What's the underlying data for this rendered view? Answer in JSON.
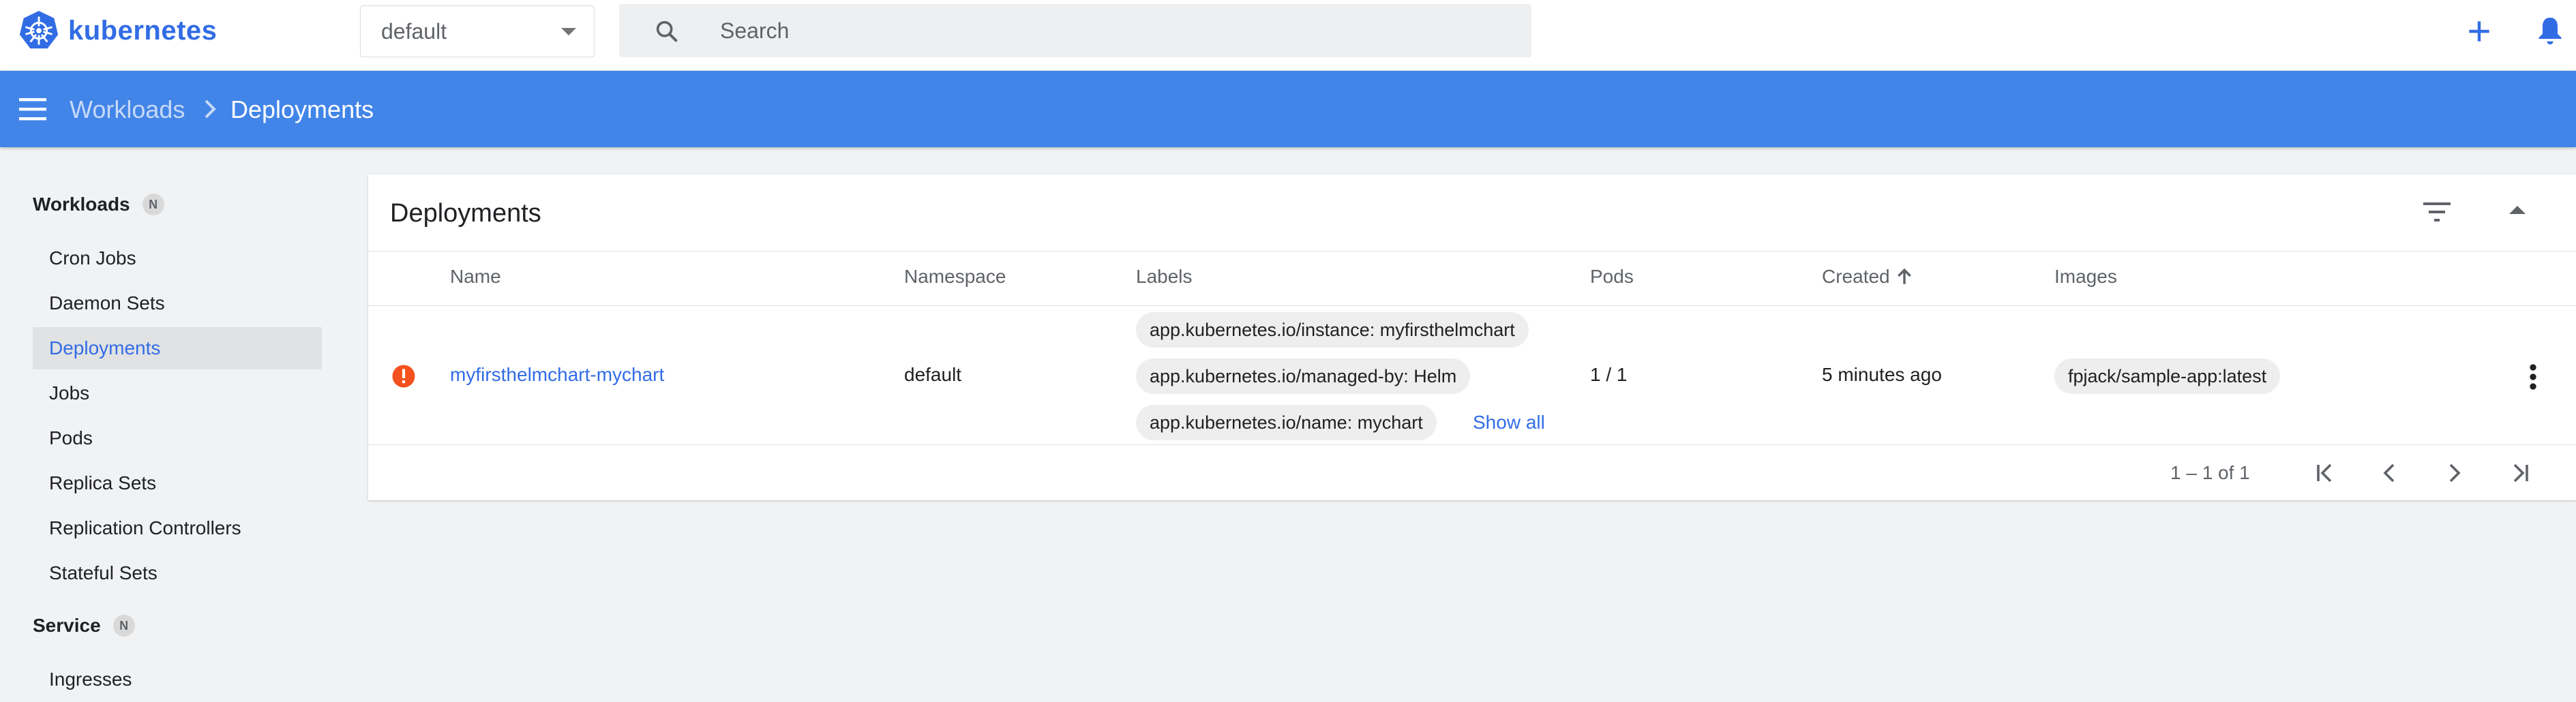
{
  "app": {
    "title": "kubernetes"
  },
  "namespace": {
    "value": "default"
  },
  "search": {
    "placeholder": "Search"
  },
  "header": {
    "breadcrumb": {
      "parent": "Workloads",
      "current": "Deployments"
    }
  },
  "sidebar": {
    "groups": [
      {
        "label": "Workloads",
        "badge": "N"
      },
      {
        "label": "Service",
        "badge": "N"
      }
    ],
    "items": [
      {
        "label": "Cron Jobs"
      },
      {
        "label": "Daemon Sets"
      },
      {
        "label": "Deployments",
        "active": true
      },
      {
        "label": "Jobs"
      },
      {
        "label": "Pods"
      },
      {
        "label": "Replica Sets"
      },
      {
        "label": "Replication Controllers"
      },
      {
        "label": "Stateful Sets"
      },
      {
        "label": "Ingresses"
      }
    ]
  },
  "card": {
    "title": "Deployments",
    "columns": [
      "Name",
      "Namespace",
      "Labels",
      "Pods",
      "Created",
      "Images"
    ],
    "rows": [
      {
        "status": "error",
        "name": "myfirsthelmchart-mychart",
        "namespace": "default",
        "labels": [
          "app.kubernetes.io/instance: myfirsthelmchart",
          "app.kubernetes.io/managed-by: Helm",
          "app.kubernetes.io/name: mychart"
        ],
        "show_all": "Show all",
        "pods": "1 / 1",
        "created": "5 minutes ago",
        "images": [
          "fpjack/sample-app:latest"
        ]
      }
    ],
    "pagination": {
      "text": "1 – 1 of 1"
    }
  },
  "colors": {
    "accent": "#326ce5",
    "header": "#4285e8",
    "error": "#f4511e"
  }
}
